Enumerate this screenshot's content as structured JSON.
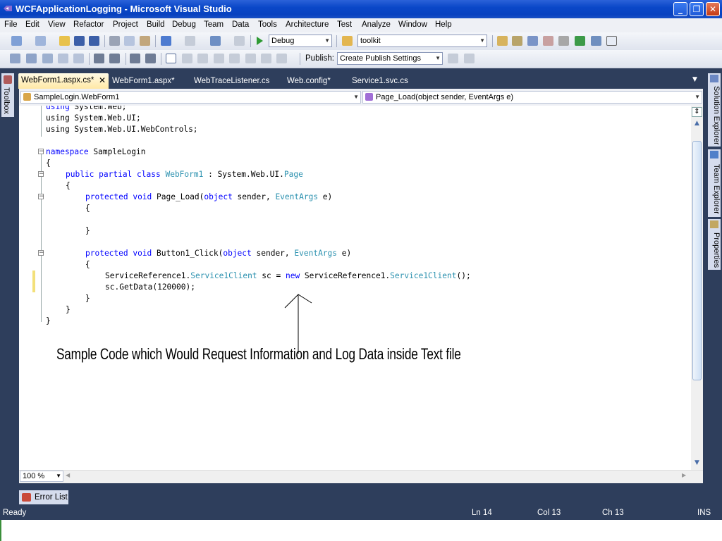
{
  "window": {
    "title": "WCFApplicationLogging - Microsoft Visual Studio",
    "min_glyph": "_",
    "max_glyph": "❐",
    "close_glyph": "✕"
  },
  "menu": {
    "items": [
      "File",
      "Edit",
      "View",
      "Refactor",
      "Project",
      "Build",
      "Debug",
      "Team",
      "Data",
      "Tools",
      "Architecture",
      "Test",
      "Analyze",
      "Window",
      "Help"
    ]
  },
  "toolbar1": {
    "config_value": "Debug",
    "find_value": "toolkit"
  },
  "toolbar2": {
    "publish_label": "Publish:",
    "publish_value": "Create Publish Settings"
  },
  "side": {
    "toolbox_label": "Toolbox",
    "solution_explorer_label": "Solution Explorer",
    "team_explorer_label": "Team Explorer",
    "properties_label": "Properties"
  },
  "tabs": [
    "WebForm1.aspx.cs*",
    "WebForm1.aspx*",
    "WebTraceListener.cs",
    "Web.config*",
    "Service1.svc.cs"
  ],
  "navbar": {
    "class_value": "SampleLogin.WebForm1",
    "member_value": "Page_Load(object sender, EventArgs e)"
  },
  "code": {
    "l1": "using System.Web;",
    "l2": "using System.Web.UI;",
    "l3": "using System.Web.UI.WebControls;",
    "ns_kw": "namespace",
    "ns_name": " SampleLogin",
    "brace_open": "{",
    "brace_close": "}",
    "class_kw": "public partial class",
    "class_name": "WebForm1",
    "class_base_prefix": " : System.Web.UI.",
    "class_base": "Page",
    "pl_kw": "protected void",
    "pl_name": " Page_Load(",
    "obj_kw": "object",
    "sender": " sender, ",
    "eventargs": "EventArgs",
    "e_close": " e)",
    "bc_name": " Button1_Click(",
    "svc_prefix": "ServiceReference1.",
    "svc_type": "Service1Client",
    "svc_mid": " sc = ",
    "new_kw": "new",
    "svc_mid2": " ServiceReference1.",
    "svc_end": "();",
    "getdata": "sc.GetData(120000);"
  },
  "annotation": "Sample Code which Would Request Information and Log Data inside Text file",
  "zoom": "100 %",
  "error_list_label": "Error List",
  "status": {
    "ready": "Ready",
    "ln": "Ln 14",
    "col": "Col 13",
    "ch": "Ch 13",
    "ins": "INS"
  },
  "colors": {
    "keyword": "#0000ff",
    "type": "#2b91af",
    "ide_dark": "#2e3e5c",
    "title_blue": "#0842c0"
  }
}
